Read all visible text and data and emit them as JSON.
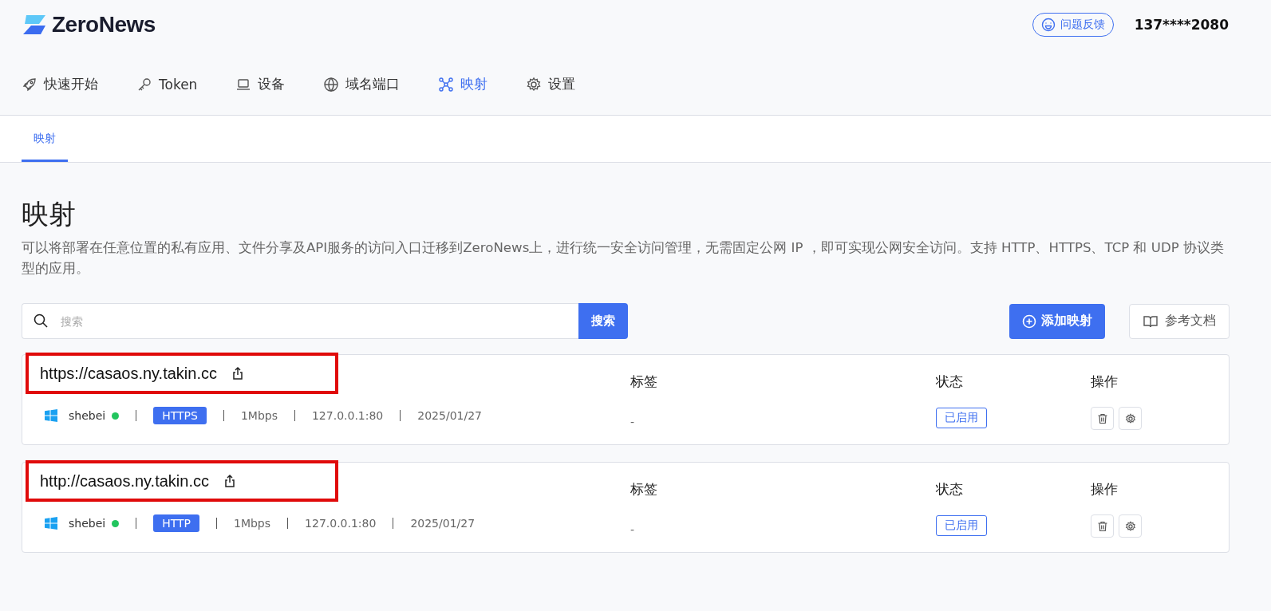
{
  "header": {
    "logo": "ZeroNews",
    "feedback": "问题反馈",
    "user": "137****2080"
  },
  "nav": [
    {
      "label": "快速开始",
      "kind": "rocket",
      "selected": false
    },
    {
      "label": "Token",
      "kind": "key",
      "selected": false
    },
    {
      "label": "设备",
      "kind": "laptop",
      "selected": false
    },
    {
      "label": "域名端口",
      "kind": "globe",
      "selected": false
    },
    {
      "label": "映射",
      "kind": "network",
      "selected": true
    },
    {
      "label": "设置",
      "kind": "gear",
      "selected": false
    }
  ],
  "subtabs": [
    {
      "label": "映射",
      "selected": true
    }
  ],
  "page": {
    "title": "映射",
    "description": "可以将部署在任意位置的私有应用、文件分享及API服务的访问入口迁移到ZeroNews上，进行统一安全访问管理，无需固定公网 IP ，即可实现公网安全访问。支持 HTTP、HTTPS、TCP 和 UDP 协议类型的应用。"
  },
  "search": {
    "placeholder": "搜索",
    "button": "搜索"
  },
  "actions": {
    "add": "添加映射",
    "docs": "参考文档"
  },
  "mappings": [
    {
      "url": "https://casaos.ny.takin.cc",
      "highlighted": true,
      "device": "shebei",
      "online": true,
      "protocol": "HTTPS",
      "bandwidth": "1Mbps",
      "target": "127.0.0.1:80",
      "date": "2025/01/27",
      "tags_header": "标签",
      "tags": "-",
      "status_header": "状态",
      "status": "已启用",
      "ops_header": "操作"
    },
    {
      "url": "http://casaos.ny.takin.cc",
      "highlighted": true,
      "device": "shebei",
      "online": true,
      "protocol": "HTTP",
      "bandwidth": "1Mbps",
      "target": "127.0.0.1:80",
      "date": "2025/01/27",
      "tags_header": "标签",
      "tags": "-",
      "status_header": "状态",
      "status": "已启用",
      "ops_header": "操作"
    }
  ]
}
